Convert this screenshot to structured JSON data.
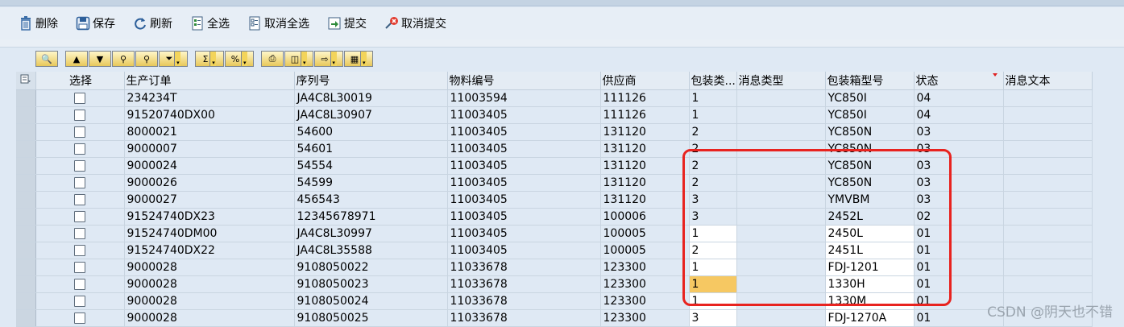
{
  "toolbar": {
    "buttons": [
      {
        "label": "删除",
        "icon": "trash-icon"
      },
      {
        "label": "保存",
        "icon": "save-icon"
      },
      {
        "label": "刷新",
        "icon": "refresh-icon"
      },
      {
        "label": "全选",
        "icon": "select-all-icon"
      },
      {
        "label": "取消全选",
        "icon": "deselect-all-icon"
      },
      {
        "label": "提交",
        "icon": "submit-icon"
      },
      {
        "label": "取消提交",
        "icon": "cancel-submit-icon"
      }
    ]
  },
  "grid": {
    "columns": [
      "选择",
      "生产订单",
      "序列号",
      "物料编号",
      "供应商",
      "包装类...",
      "消息类型",
      "包装箱型号",
      "状态",
      "消息文本"
    ],
    "rows": [
      {
        "order": "234234T",
        "serial": "JA4C8L30019",
        "material": "11003594",
        "vendor": "111126",
        "pack_type": "1",
        "msg_type": "",
        "box_model": "YC850I",
        "status": "04",
        "msg_text": ""
      },
      {
        "order": "91520740DX00",
        "serial": "JA4C8L30907",
        "material": "11003405",
        "vendor": "111126",
        "pack_type": "1",
        "msg_type": "",
        "box_model": "YC850I",
        "status": "04",
        "msg_text": ""
      },
      {
        "order": "8000021",
        "serial": "54600",
        "material": "11003405",
        "vendor": "131120",
        "pack_type": "2",
        "msg_type": "",
        "box_model": "YC850N",
        "status": "03",
        "msg_text": ""
      },
      {
        "order": "9000007",
        "serial": "54601",
        "material": "11003405",
        "vendor": "131120",
        "pack_type": "2",
        "msg_type": "",
        "box_model": "YC850N",
        "status": "03",
        "msg_text": ""
      },
      {
        "order": "9000024",
        "serial": "54554",
        "material": "11003405",
        "vendor": "131120",
        "pack_type": "2",
        "msg_type": "",
        "box_model": "YC850N",
        "status": "03",
        "msg_text": ""
      },
      {
        "order": "9000026",
        "serial": "54599",
        "material": "11003405",
        "vendor": "131120",
        "pack_type": "2",
        "msg_type": "",
        "box_model": "YC850N",
        "status": "03",
        "msg_text": ""
      },
      {
        "order": "9000027",
        "serial": "456543",
        "material": "11003405",
        "vendor": "131120",
        "pack_type": "3",
        "msg_type": "",
        "box_model": "YMVBM",
        "status": "03",
        "msg_text": ""
      },
      {
        "order": "91524740DX23",
        "serial": "12345678971",
        "material": "11003405",
        "vendor": "100006",
        "pack_type": "3",
        "msg_type": "",
        "box_model": "2452L",
        "status": "02",
        "msg_text": ""
      },
      {
        "order": "91524740DM00",
        "serial": "JA4C8L30997",
        "material": "11003405",
        "vendor": "100005",
        "pack_type": "1",
        "msg_type": "",
        "box_model": "2450L",
        "status": "01",
        "msg_text": ""
      },
      {
        "order": "91524740DX22",
        "serial": "JA4C8L35588",
        "material": "11003405",
        "vendor": "100005",
        "pack_type": "2",
        "msg_type": "",
        "box_model": "2451L",
        "status": "01",
        "msg_text": ""
      },
      {
        "order": "9000028",
        "serial": "9108050022",
        "material": "11033678",
        "vendor": "123300",
        "pack_type": "1",
        "msg_type": "",
        "box_model": "FDJ-1201",
        "status": "01",
        "msg_text": ""
      },
      {
        "order": "9000028",
        "serial": "9108050023",
        "material": "11033678",
        "vendor": "123300",
        "pack_type": "1",
        "msg_type": "",
        "box_model": "1330H",
        "status": "01",
        "msg_text": ""
      },
      {
        "order": "9000028",
        "serial": "9108050024",
        "material": "11033678",
        "vendor": "123300",
        "pack_type": "1",
        "msg_type": "",
        "box_model": "1330M",
        "status": "01",
        "msg_text": ""
      },
      {
        "order": "9000028",
        "serial": "9108050025",
        "material": "11033678",
        "vendor": "123300",
        "pack_type": "3",
        "msg_type": "",
        "box_model": "FDJ-1270A",
        "status": "01",
        "msg_text": ""
      }
    ]
  },
  "watermark": "CSDN @阴天也不错",
  "colors": {
    "annotation_red": "#e8231f",
    "highlight_cell": "#f6c862"
  }
}
